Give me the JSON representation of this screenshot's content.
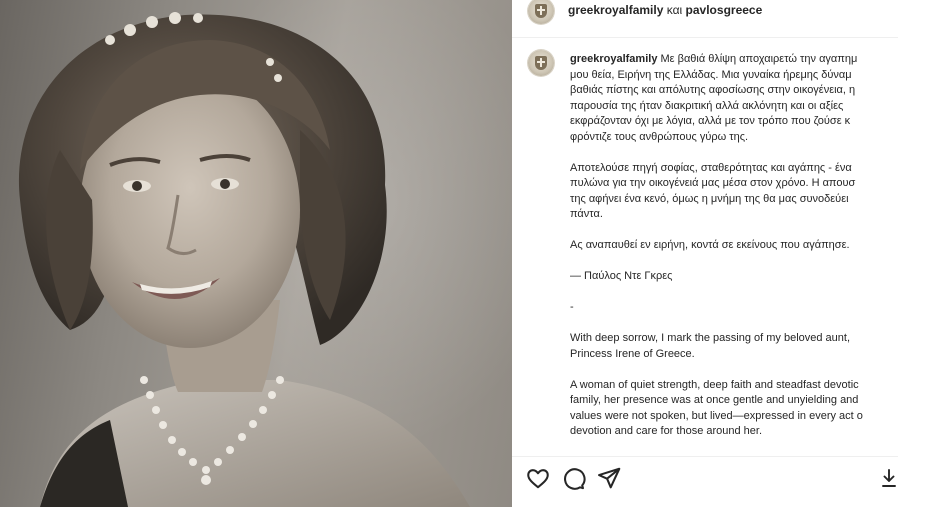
{
  "photo": {
    "alt_subject": "sepia portrait"
  },
  "header": {
    "author_1": "greekroyalfamily",
    "connector": "και",
    "author_2": "pavlosgreece",
    "avatar_icon": "royal-crest-icon"
  },
  "caption": {
    "username": "greekroyalfamily",
    "greek_p1": [
      "Με βαθιά θλίψη αποχαιρετώ την αγαπημ",
      "μου θεία, Ειρήνη της Ελλάδας. Μια γυναίκα ήρεμης δύναμ",
      "βαθιάς πίστης και απόλυτης αφοσίωσης στην οικογένεια, η",
      "παρουσία της ήταν διακριτική αλλά ακλόνητη και οι αξίες",
      "εκφράζονταν όχι με λόγια, αλλά με τον τρόπο που ζούσε κ",
      "φρόντιζε τους ανθρώπους γύρω της."
    ],
    "greek_p2": [
      "Αποτελούσε πηγή σοφίας, σταθερότητας και αγάπης - ένα",
      "πυλώνα για την οικογένειά μας μέσα στον χρόνο. Η απουσ",
      "της αφήνει ένα κενό, όμως η μνήμη της θα μας συνοδεύει",
      "πάντα."
    ],
    "greek_p3": "Ας αναπαυθεί εν ειρήνη, κοντά σε εκείνους που αγάπησε.",
    "signature": "— Παύλος Ντε Γκρες",
    "separator": "-",
    "english_p1": [
      "With deep sorrow, I mark the passing of my beloved aunt,",
      "Princess Irene of Greece."
    ],
    "english_p2": [
      "A woman of quiet strength, deep faith and steadfast devotic",
      "family, her presence was at once gentle and unyielding and",
      "values were not spoken, but lived—expressed in every act o",
      "devotion and care for those around her."
    ]
  },
  "actions": {
    "like_icon": "heart-icon",
    "comment_icon": "comment-bubble-icon",
    "share_icon": "paper-plane-icon",
    "save_icon": "download-icon"
  }
}
